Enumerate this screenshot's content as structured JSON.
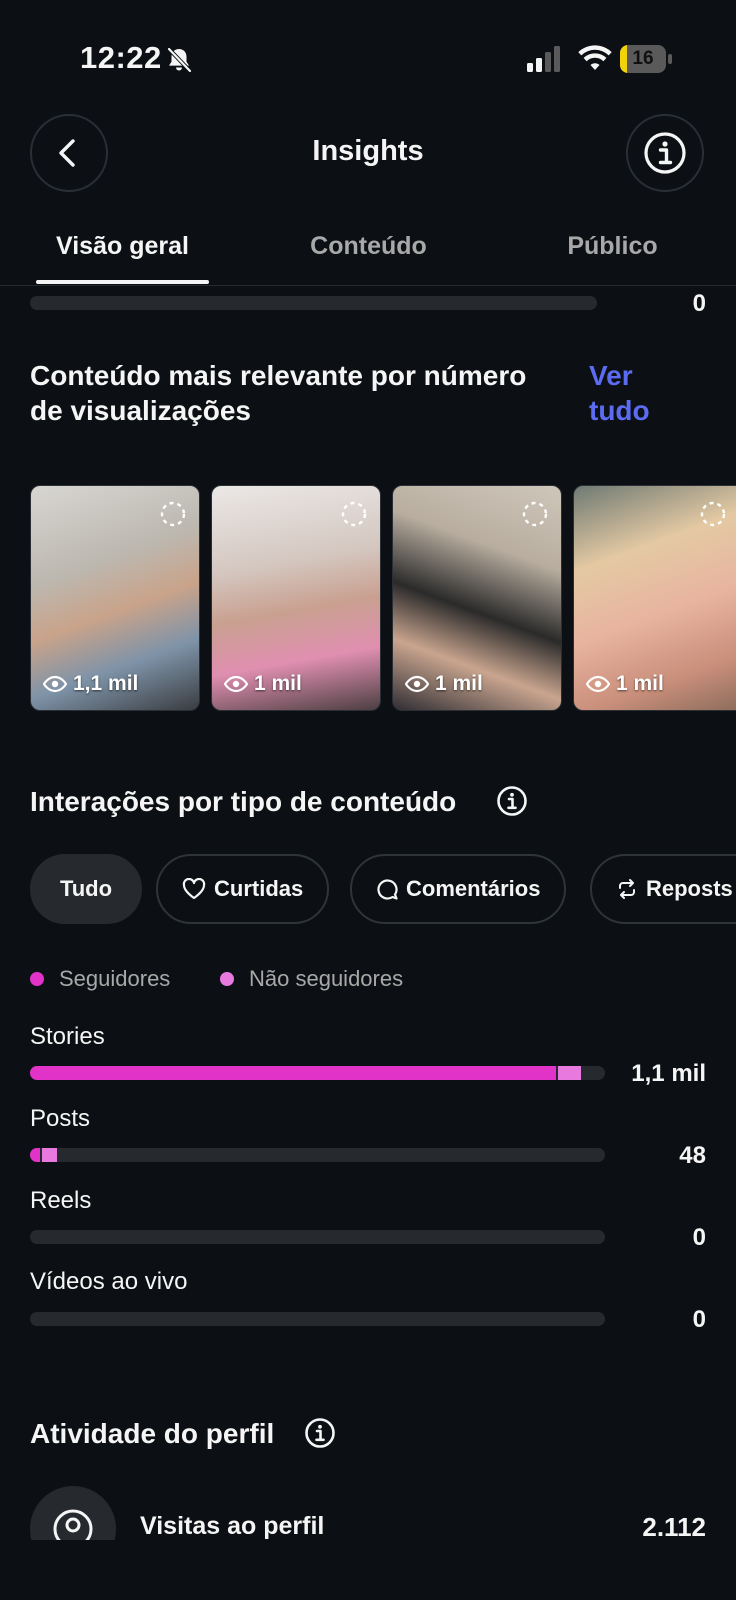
{
  "status_bar": {
    "time": "12:22",
    "battery": "16",
    "battery_level": 0.16
  },
  "header": {
    "title": "Insights"
  },
  "tabs": [
    {
      "label": "Visão geral"
    },
    {
      "label": "Conteúdo"
    },
    {
      "label": "Público"
    }
  ],
  "top_row": {
    "value": "0",
    "fill": 0
  },
  "relevant": {
    "title_line1": "Conteúdo mais relevante por número",
    "title_line2": "de visualizações",
    "see_all_line1": "Ver",
    "see_all_line2": "tudo",
    "items": [
      {
        "views": "1,1 mil"
      },
      {
        "views": "1 mil"
      },
      {
        "views": "1 mil"
      },
      {
        "views": "1 mil"
      }
    ]
  },
  "interactions": {
    "title": "Interações por tipo de conteúdo",
    "chips": [
      {
        "label": "Tudo"
      },
      {
        "label": "Curtidas"
      },
      {
        "label": "Comentários"
      },
      {
        "label": "Reposts"
      }
    ],
    "legend": [
      {
        "label": "Seguidores",
        "color": "#e133c7"
      },
      {
        "label": "Não seguidores",
        "color": "#e87adf"
      }
    ],
    "rows": [
      {
        "label": "Stories",
        "value": "1,1 mil",
        "followers": 0.915,
        "non_followers": 0.04
      },
      {
        "label": "Posts",
        "value": "48",
        "followers": 0.017,
        "non_followers": 0.026
      },
      {
        "label": "Reels",
        "value": "0",
        "followers": 0,
        "non_followers": 0
      },
      {
        "label": "Vídeos ao vivo",
        "value": "0",
        "followers": 0,
        "non_followers": 0
      }
    ]
  },
  "profile_activity": {
    "title": "Atividade do perfil",
    "visits_label": "Visitas ao perfil",
    "visits_value": "2.112"
  }
}
